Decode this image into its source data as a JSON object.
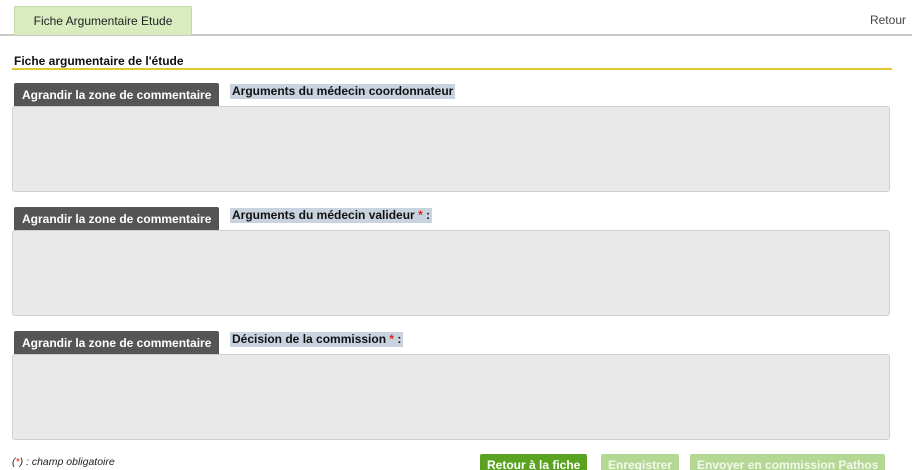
{
  "header": {
    "tab_label": "Fiche Argumentaire Etude",
    "back_link": "Retour"
  },
  "section": {
    "title": "Fiche argumentaire de l'étude"
  },
  "fields": [
    {
      "expand_label": "Agrandir la zone de commentaire",
      "label": "Arguments du médecin coordonnateur",
      "required": false,
      "value": ""
    },
    {
      "expand_label": "Agrandir la zone de commentaire",
      "label": "Arguments du médecin valideur",
      "required": true,
      "required_marker": "*",
      "suffix": ":",
      "value": ""
    },
    {
      "expand_label": "Agrandir la zone de commentaire",
      "label": "Décision de la commission",
      "required": true,
      "required_marker": "*",
      "suffix": ":",
      "value": ""
    }
  ],
  "footer": {
    "legend_open": "(",
    "legend_star": "*",
    "legend_close": ")",
    "legend_text": " : champ obligatoire",
    "buttons": {
      "back": "Retour à la fiche",
      "save": "Enregistrer",
      "send": "Envoyer en commission Pathos"
    }
  },
  "colors": {
    "tab_bg": "#d9ecc0",
    "section_rule": "#e2c82a",
    "expand_button": "#555555",
    "label_highlight": "#c9d3e0",
    "primary_button": "#5aa321",
    "disabled_button": "#b4d893",
    "required_marker": "#dd2222"
  }
}
